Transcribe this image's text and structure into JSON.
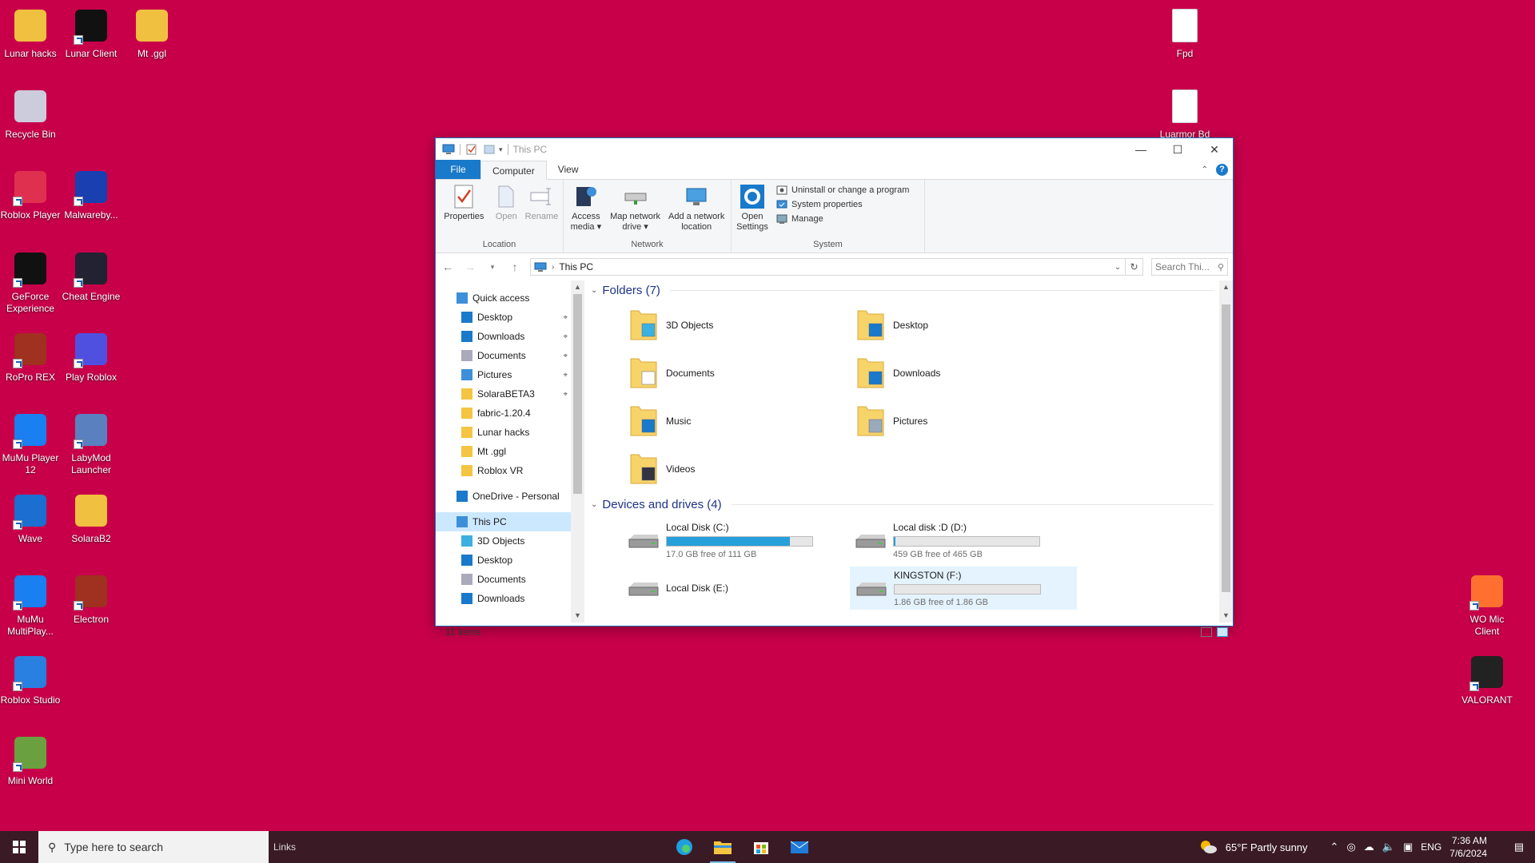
{
  "desktop": {
    "icons": [
      {
        "label": "Lunar hacks"
      },
      {
        "label": "Lunar Client"
      },
      {
        "label": "Mt .ggl"
      },
      {
        "label": "Recycle Bin"
      },
      {
        "label": "Roblox Player"
      },
      {
        "label": "Malwareby..."
      },
      {
        "label": "GeForce Experience"
      },
      {
        "label": "Cheat Engine"
      },
      {
        "label": "RoPro REX"
      },
      {
        "label": "Play Roblox"
      },
      {
        "label": "MuMu Player 12"
      },
      {
        "label": "LabyMod Launcher"
      },
      {
        "label": "Wave"
      },
      {
        "label": "SolaraB2"
      },
      {
        "label": "MuMu MultiPlay..."
      },
      {
        "label": "Electron"
      },
      {
        "label": "Roblox Studio"
      },
      {
        "label": "Mini World"
      },
      {
        "label": "Fpd"
      },
      {
        "label": "Luarmor Bd"
      },
      {
        "label": "WO Mic Client"
      },
      {
        "label": "VALORANT"
      }
    ],
    "background_color": "#c8004a"
  },
  "window": {
    "title": "This PC",
    "tabs": {
      "file": "File",
      "computer": "Computer",
      "view": "View"
    },
    "ribbon": {
      "location": {
        "label": "Location",
        "properties": "Properties",
        "open": "Open",
        "rename": "Rename"
      },
      "network": {
        "label": "Network",
        "access_media": "Access media ▾",
        "map_drive": "Map network drive ▾",
        "add_location": "Add a network location"
      },
      "system": {
        "label": "System",
        "open_settings": "Open Settings",
        "uninstall": "Uninstall or change a program",
        "sys_props": "System properties",
        "manage": "Manage"
      }
    },
    "address": {
      "path": "This PC",
      "search_placeholder": "Search Thi..."
    },
    "nav": {
      "quick_access": "Quick access",
      "quick_items": [
        "Desktop",
        "Downloads",
        "Documents",
        "Pictures",
        "SolaraBETA3",
        "fabric-1.20.4",
        "Lunar hacks",
        "Mt .ggl",
        "Roblox VR"
      ],
      "onedrive": "OneDrive - Personal",
      "this_pc": "This PC",
      "pc_items": [
        "3D Objects",
        "Desktop",
        "Documents",
        "Downloads"
      ]
    },
    "folders_header": "Folders (7)",
    "folders": [
      "3D Objects",
      "Desktop",
      "Documents",
      "Downloads",
      "Music",
      "Pictures",
      "Videos"
    ],
    "drives_header": "Devices and drives (4)",
    "drives": [
      {
        "name": "Local Disk (C:)",
        "free": "17.0 GB free of 111 GB",
        "used_fraction": 0.847,
        "has_bar": true
      },
      {
        "name": "Local disk :D (D:)",
        "free": "459 GB free of 465 GB",
        "used_fraction": 0.013,
        "has_bar": true
      },
      {
        "name": "Local Disk (E:)",
        "free": "",
        "used_fraction": 0,
        "has_bar": false
      },
      {
        "name": "KINGSTON (F:)",
        "free": "1.86 GB free of 1.86 GB",
        "used_fraction": 0.0,
        "has_bar": true
      }
    ],
    "status": "11 items"
  },
  "taskbar": {
    "search_placeholder": "Type here to search",
    "links": "Links",
    "weather": "65°F  Partly sunny",
    "lang": "ENG",
    "time": "7:36 AM",
    "date": "7/6/2024"
  }
}
